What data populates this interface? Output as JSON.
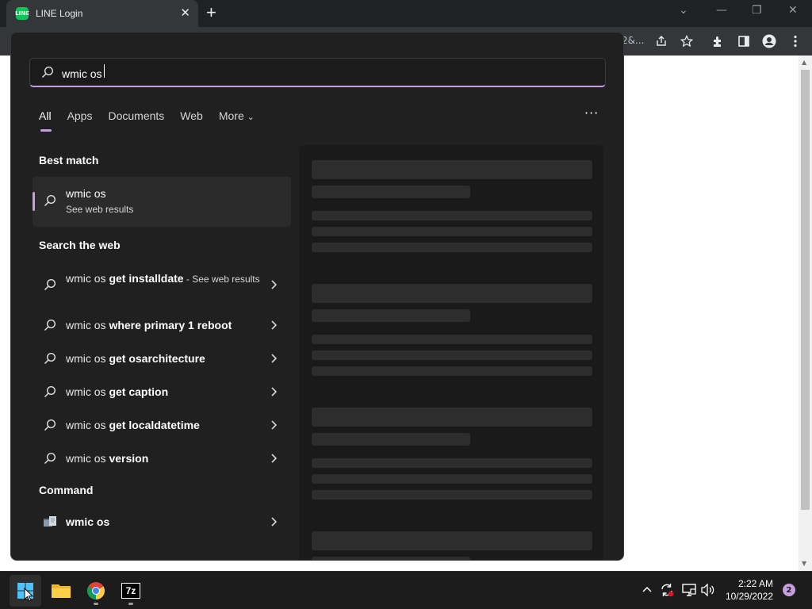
{
  "browser": {
    "tab_title": "LINE Login",
    "favicon_text": "LINE",
    "close_glyph": "✕",
    "newtab_glyph": "+",
    "omnibox_tail": "2&...",
    "window_controls": {
      "dropdown": "⌄",
      "minimize": "—",
      "restore": "❐",
      "close": "✕"
    },
    "toolbar_icons": [
      "share-icon",
      "star-icon",
      "extensions-icon",
      "side-panel-icon",
      "profile-icon",
      "menu-icon"
    ]
  },
  "search": {
    "query": "wmic os",
    "filters": [
      "All",
      "Apps",
      "Documents",
      "Web",
      "More"
    ],
    "more_chevron": "⌄",
    "ellipsis": "···"
  },
  "best_match": {
    "heading": "Best match",
    "title": "wmic os",
    "subtitle": "See web results"
  },
  "web_section": {
    "heading": "Search the web",
    "items": [
      {
        "prefix": "wmic os ",
        "bold": "get installdate",
        "suffix": " - See web results"
      },
      {
        "prefix": "wmic os ",
        "bold": "where primary 1 reboot",
        "suffix": ""
      },
      {
        "prefix": "wmic os ",
        "bold": "get osarchitecture",
        "suffix": ""
      },
      {
        "prefix": "wmic os ",
        "bold": "get caption",
        "suffix": ""
      },
      {
        "prefix": "wmic os ",
        "bold": "get localdatetime",
        "suffix": ""
      },
      {
        "prefix": "wmic os ",
        "bold": "version",
        "suffix": ""
      }
    ]
  },
  "command_section": {
    "heading": "Command",
    "title": "wmic os"
  },
  "taskbar": {
    "apps": [
      "start-icon",
      "file-explorer-icon",
      "chrome-icon",
      "7zip-icon"
    ],
    "sevenzip_label": "7z",
    "time": "2:22 AM",
    "date": "10/29/2022",
    "notification_count": "2",
    "tray_icons": [
      "chevron-up-icon",
      "sync-icon",
      "network-icon",
      "volume-icon"
    ]
  },
  "colors": {
    "accent": "#c79ee0",
    "flyout_bg": "#202020",
    "line_green": "#06c755"
  }
}
